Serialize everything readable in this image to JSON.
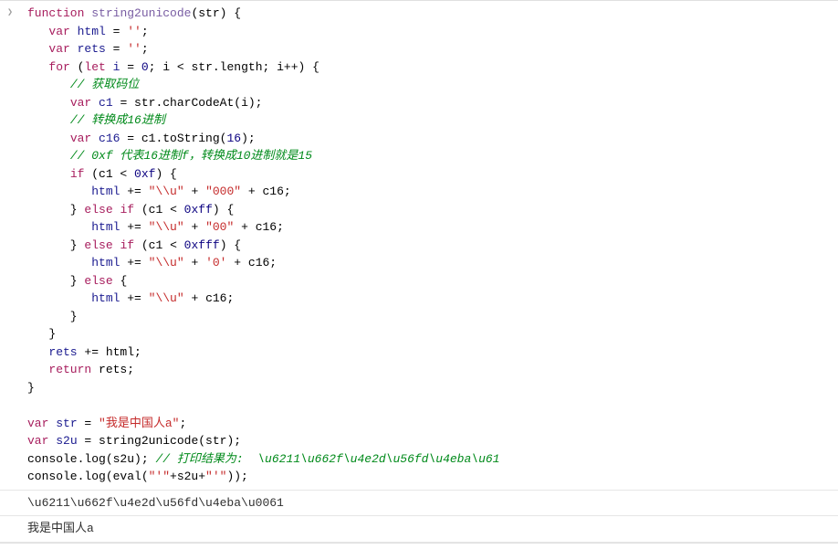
{
  "code": {
    "l1": {
      "pre": "",
      "kw1": "function",
      "sp1": " ",
      "fn": "string2unicode",
      "paren": "(str) {"
    },
    "l2": {
      "pre": "   ",
      "kw": "var",
      "sp": " ",
      "id": "html",
      "rest": " = ",
      "str": "''",
      "end": ";"
    },
    "l3": {
      "pre": "   ",
      "kw": "var",
      "sp": " ",
      "id": "rets",
      "rest": " = ",
      "str": "''",
      "end": ";"
    },
    "l4": {
      "pre": "   ",
      "kw1": "for",
      "sp1": " (",
      "kw2": "let",
      "sp2": " ",
      "id": "i",
      "rest1": " = ",
      "num1": "0",
      "rest2": "; i < str.length; i++) {"
    },
    "l5": {
      "pre": "      ",
      "com": "// 获取码位"
    },
    "l6": {
      "pre": "      ",
      "kw": "var",
      "sp": " ",
      "id": "c1",
      "rest": " = str.charCodeAt(i);"
    },
    "l7": {
      "pre": "      ",
      "com": "// 转换成16进制"
    },
    "l8": {
      "pre": "      ",
      "kw": "var",
      "sp": " ",
      "id": "c16",
      "rest1": " = c1.toString(",
      "num": "16",
      "rest2": ");"
    },
    "l9": {
      "pre": "      ",
      "com": "// 0xf 代表16进制f，转换成10进制就是15"
    },
    "l10": {
      "pre": "      ",
      "kw": "if",
      "rest1": " (c1 < ",
      "num": "0xf",
      "rest2": ") {"
    },
    "l11": {
      "pre": "         ",
      "id": "html",
      "rest1": " += ",
      "str1": "\"\\\\u\"",
      "rest2": " + ",
      "str2": "\"000\"",
      "rest3": " + c16;"
    },
    "l12": {
      "pre": "      } ",
      "kw1": "else",
      "sp1": " ",
      "kw2": "if",
      "rest1": " (c1 < ",
      "num": "0xff",
      "rest2": ") {"
    },
    "l13": {
      "pre": "         ",
      "id": "html",
      "rest1": " += ",
      "str1": "\"\\\\u\"",
      "rest2": " + ",
      "str2": "\"00\"",
      "rest3": " + c16;"
    },
    "l14": {
      "pre": "      } ",
      "kw1": "else",
      "sp1": " ",
      "kw2": "if",
      "rest1": " (c1 < ",
      "num": "0xfff",
      "rest2": ") {"
    },
    "l15": {
      "pre": "         ",
      "id": "html",
      "rest1": " += ",
      "str1": "\"\\\\u\"",
      "rest2": " + ",
      "str2": "'0'",
      "rest3": " + c16;"
    },
    "l16": {
      "pre": "      } ",
      "kw": "else",
      "rest": " {"
    },
    "l17": {
      "pre": "         ",
      "id": "html",
      "rest1": " += ",
      "str1": "\"\\\\u\"",
      "rest2": " + c16;"
    },
    "l18": {
      "pre": "      }",
      "rest": ""
    },
    "l19": {
      "pre": "   }",
      "rest": ""
    },
    "l20": {
      "pre": "   ",
      "id": "rets",
      "rest": " += html;"
    },
    "l21": {
      "pre": "   ",
      "kw": "return",
      "rest": " rets;"
    },
    "l22": {
      "pre": "}",
      "rest": ""
    },
    "l23": {
      "pre": "",
      "rest": ""
    },
    "l24": {
      "pre": "",
      "kw": "var",
      "sp": " ",
      "id": "str",
      "rest": " = ",
      "str": "\"我是中国人a\"",
      "end": ";"
    },
    "l25": {
      "pre": "",
      "kw": "var",
      "sp": " ",
      "id": "s2u",
      "rest": " = string2unicode(str);"
    },
    "l26": {
      "pre": "",
      "call": "console.log(s2u); ",
      "com": "// 打印结果为:  \\u6211\\u662f\\u4e2d\\u56fd\\u4eba\\u61"
    },
    "l27": {
      "pre": "",
      "call1": "console.log(eval(",
      "str1": "\"'\"",
      "rest1": "+s2u+",
      "str2": "\"'\"",
      "call2": "));"
    }
  },
  "output": {
    "line1": "\\u6211\\u662f\\u4e2d\\u56fd\\u4eba\\u0061",
    "line2": "我是中国人a"
  },
  "ui": {
    "expand_glyph": "❯"
  }
}
